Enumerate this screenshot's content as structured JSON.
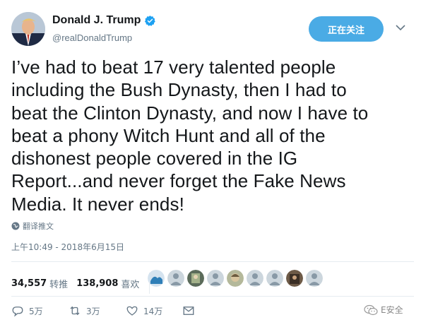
{
  "author": {
    "name": "Donald J. Trump",
    "handle": "@realDonaldTrump",
    "verified": true
  },
  "follow_button": {
    "label": "正在关注"
  },
  "tweet": {
    "text": "I’ve had to beat 17 very talented people\nincluding the Bush Dynasty, then I had to\nbeat the Clinton Dynasty, and now I have to\nbeat a phony Witch Hunt and all of the\ndishonest people covered in the IG\nReport...and never forget the Fake News\nMedia. It never ends!",
    "translate_label": "翻译推文",
    "timestamp": "上午10:49 - 2018年6月15日"
  },
  "stats": {
    "retweets": "34,557",
    "retweets_label": "转推",
    "likes": "138,908",
    "likes_label": "喜欢"
  },
  "liker_avatars": [
    "liker-avatar-1",
    "liker-avatar-2",
    "liker-avatar-3",
    "liker-avatar-4",
    "liker-avatar-5",
    "liker-avatar-6",
    "liker-avatar-7",
    "liker-avatar-8",
    "liker-avatar-9"
  ],
  "actions": {
    "reply_count": "5万",
    "retweet_count": "3万",
    "like_count": "14万"
  },
  "watermark": {
    "text": "E安全"
  },
  "colors": {
    "accent": "#4aabe5",
    "text": "#14171a",
    "secondary": "#657786",
    "verified": "#1da1f2"
  }
}
